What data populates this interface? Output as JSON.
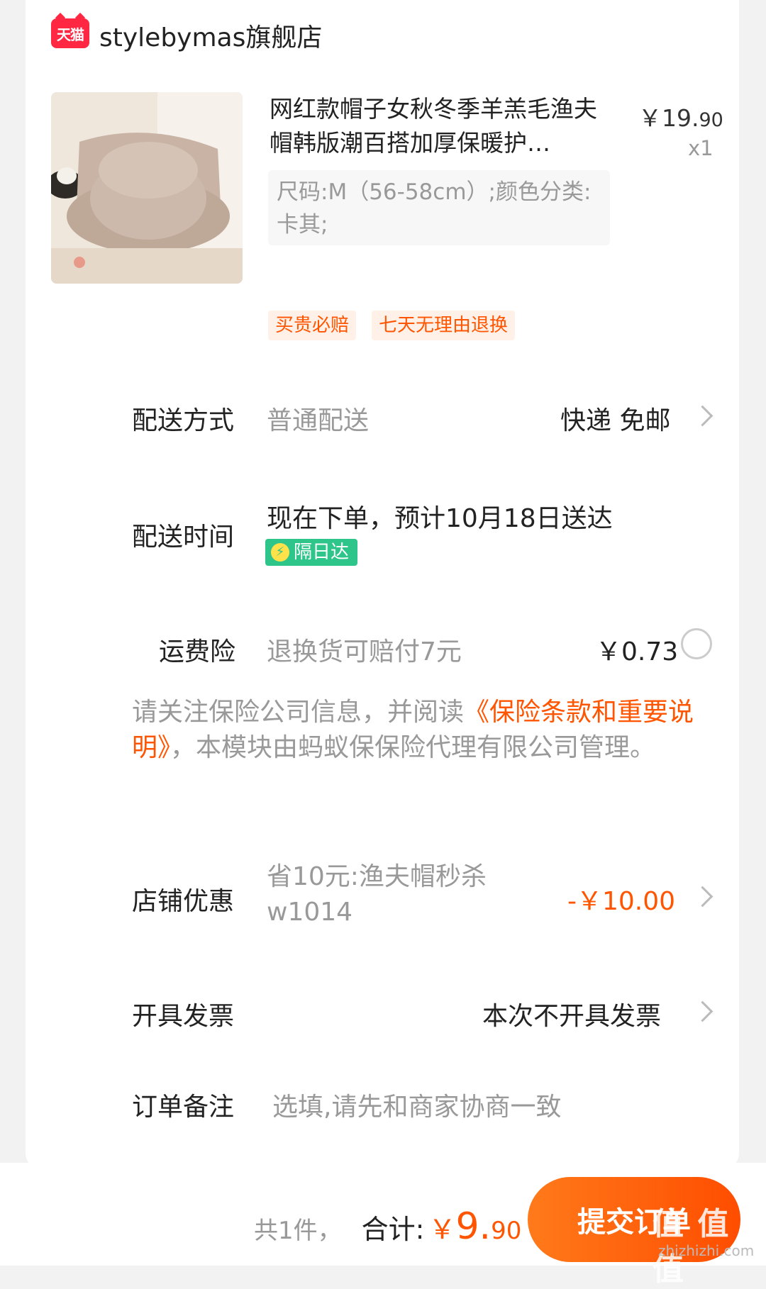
{
  "shop": {
    "logo_text": "天猫",
    "name": "stylebymas旗舰店"
  },
  "product": {
    "image_icon": "bucket-hat-photo",
    "title": "网红款帽子女秋冬季羊羔毛渔夫帽韩版潮百搭加厚保暖护…",
    "price_symbol": "￥",
    "price_int": "19.",
    "price_cents": "90",
    "quantity": "x1",
    "sku": "尺码:M（56-58cm）;颜色分类:卡其;"
  },
  "tags": [
    "买贵必赔",
    "七天无理由退换"
  ],
  "delivery_method": {
    "label": "配送方式",
    "value": "普通配送",
    "right": "快递 免邮"
  },
  "delivery_time": {
    "label": "配送时间",
    "value": "现在下单，预计10月18日送达",
    "badge": "隔日达",
    "badge_icon": "lightning-icon"
  },
  "shipping_insurance": {
    "label": "运费险",
    "value": "退换货可赔付7元",
    "price": "￥0.73"
  },
  "notice": {
    "prefix": "请关注保险公司信息，并阅读",
    "link": "《保险条款和重要说明》",
    "suffix": "，本模块由蚂蚁保保险代理有限公司管理。"
  },
  "store_discount": {
    "label": "店铺优惠",
    "value": "省10元:渔夫帽秒杀w1014",
    "amount": "-￥10.00"
  },
  "invoice": {
    "label": "开具发票",
    "value": "本次不开具发票"
  },
  "remark": {
    "label": "订单备注",
    "placeholder": "选填,请先和商家协商一致"
  },
  "footer": {
    "count": "共1件，",
    "total_label": "合计:",
    "total_symbol": "￥",
    "total_int": "9.",
    "total_cents": "90",
    "submit": "提交订单",
    "watermark": "值 值 值",
    "watermark_url": "zhizhizhi.com"
  },
  "colors": {
    "accent": "#ff5500",
    "tmall_red": "#ff2741",
    "badge_green": "#2ec58a"
  }
}
